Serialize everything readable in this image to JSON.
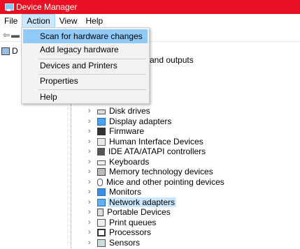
{
  "window": {
    "title": "Device Manager"
  },
  "menubar": {
    "items": [
      "File",
      "Action",
      "View",
      "Help"
    ]
  },
  "toolbar": {
    "back_icon": "back-arrow-icon",
    "forward_icon": "forward-arrow-icon"
  },
  "tree": {
    "root_label_partial": "D",
    "partial_visible_text": "and outputs",
    "items": [
      {
        "label": "Disk drives",
        "icon": "disk-drive-icon"
      },
      {
        "label": "Display adapters",
        "icon": "display-adapter-icon"
      },
      {
        "label": "Firmware",
        "icon": "firmware-icon"
      },
      {
        "label": "Human Interface Devices",
        "icon": "hid-icon"
      },
      {
        "label": "IDE ATA/ATAPI controllers",
        "icon": "ide-controller-icon"
      },
      {
        "label": "Keyboards",
        "icon": "keyboard-icon"
      },
      {
        "label": "Memory technology devices",
        "icon": "memory-icon"
      },
      {
        "label": "Mice and other pointing devices",
        "icon": "mouse-icon"
      },
      {
        "label": "Monitors",
        "icon": "monitor-icon"
      },
      {
        "label": "Network adapters",
        "icon": "network-adapter-icon",
        "selected": true
      },
      {
        "label": "Portable Devices",
        "icon": "portable-device-icon"
      },
      {
        "label": "Print queues",
        "icon": "printer-icon"
      },
      {
        "label": "Processors",
        "icon": "processor-icon"
      },
      {
        "label": "Sensors",
        "icon": "sensor-icon"
      }
    ]
  },
  "action_menu": {
    "items": [
      {
        "label": "Scan for hardware changes",
        "highlighted": true
      },
      {
        "label": "Add legacy hardware"
      },
      {
        "label": "Devices and Printers"
      },
      {
        "label": "Properties"
      },
      {
        "label": "Help"
      }
    ]
  },
  "colors": {
    "titlebar": "#e81123",
    "highlight": "#91c9f7",
    "selection": "#cce8ff"
  }
}
